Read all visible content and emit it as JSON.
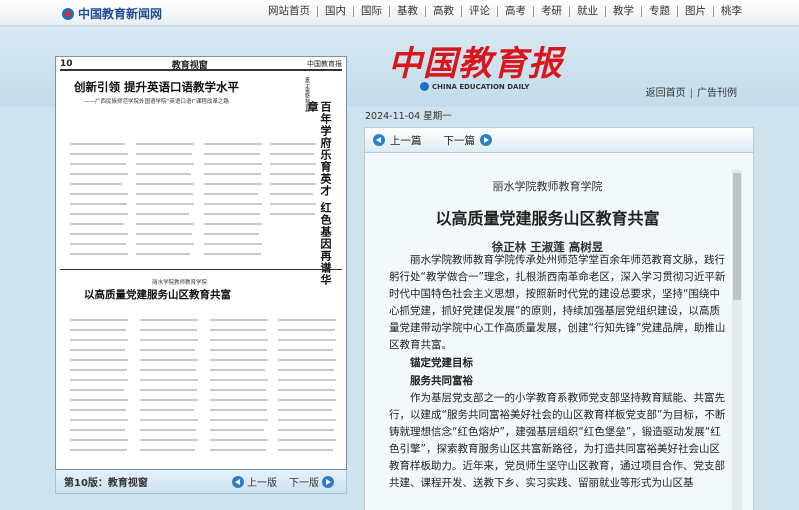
{
  "site": {
    "logo_text": "中国教育新闻网",
    "nav": [
      "网站首页",
      "国内",
      "国际",
      "基教",
      "高教",
      "评论",
      "高考",
      "考研",
      "就业",
      "教学",
      "专题",
      "图片",
      "桃李"
    ]
  },
  "header": {
    "masthead": "中国教育报",
    "masthead_en": "CHINA EDUCATION DAILY",
    "back_home": "返回首页",
    "sep": "|",
    "ad_index": "广告刊例",
    "date": "2024-11-04 星期一"
  },
  "page_preview": {
    "page_num": "10",
    "section": "教育视窗",
    "brand": "中国教育报",
    "headline1": "创新引领  提升英语口语教学水平",
    "headline1_sub": "——广西民族师范学院外国语学院“英语口语Ⅰ”课程改革之路",
    "vert_small": "景宁畲族自治县",
    "vert_big": "百年学府乐育英才  红色基因再谱华章",
    "label2": "丽水学院教师教育学院",
    "headline2": "以高质量党建服务山区教育共富"
  },
  "page_footer": {
    "label": "第10版：教育视窗",
    "prev": "上一版",
    "next": "下一版"
  },
  "article_nav": {
    "prev": "上一篇",
    "next": "下一篇"
  },
  "article": {
    "kicker": "丽水学院教师教育学院",
    "title": "以高质量党建服务山区教育共富",
    "authors": "徐正林  王淑莲  高树昱",
    "p1": "丽水学院教师教育学院传承处州师范学堂百余年师范教育文脉，践行躬行处“教学做合一”理念，扎根浙西南革命老区，深入学习贯彻习近平新时代中国特色社会主义思想，按照新时代党的建设总要求，坚持“围绕中心抓党建，抓好党建促发展”的原则，持续加强基层党组织建设，以高质量党建带动学院中心工作高质量发展，创建“行知先锋”党建品牌，助推山区教育共富。",
    "h1": "锚定党建目标",
    "h2": "服务共同富裕",
    "p2": "作为基层党支部之一的小学教育系教师党支部坚持教育赋能、共富先行，以建成“服务共同富裕美好社会的山区教育样板党支部”为目标，不断铸就理想信念“红色熔炉”，建强基层组织“红色堡垒”，锻造驱动发展“红色引擎”，探索教育服务山区共富新路径，为打造共同富裕美好社会山区教育样板助力。近年来，党员师生坚守山区教育，通过项目合作、党支部共建、课程开发、送教下乡、实习实践、留丽就业等形式为山区基"
  }
}
